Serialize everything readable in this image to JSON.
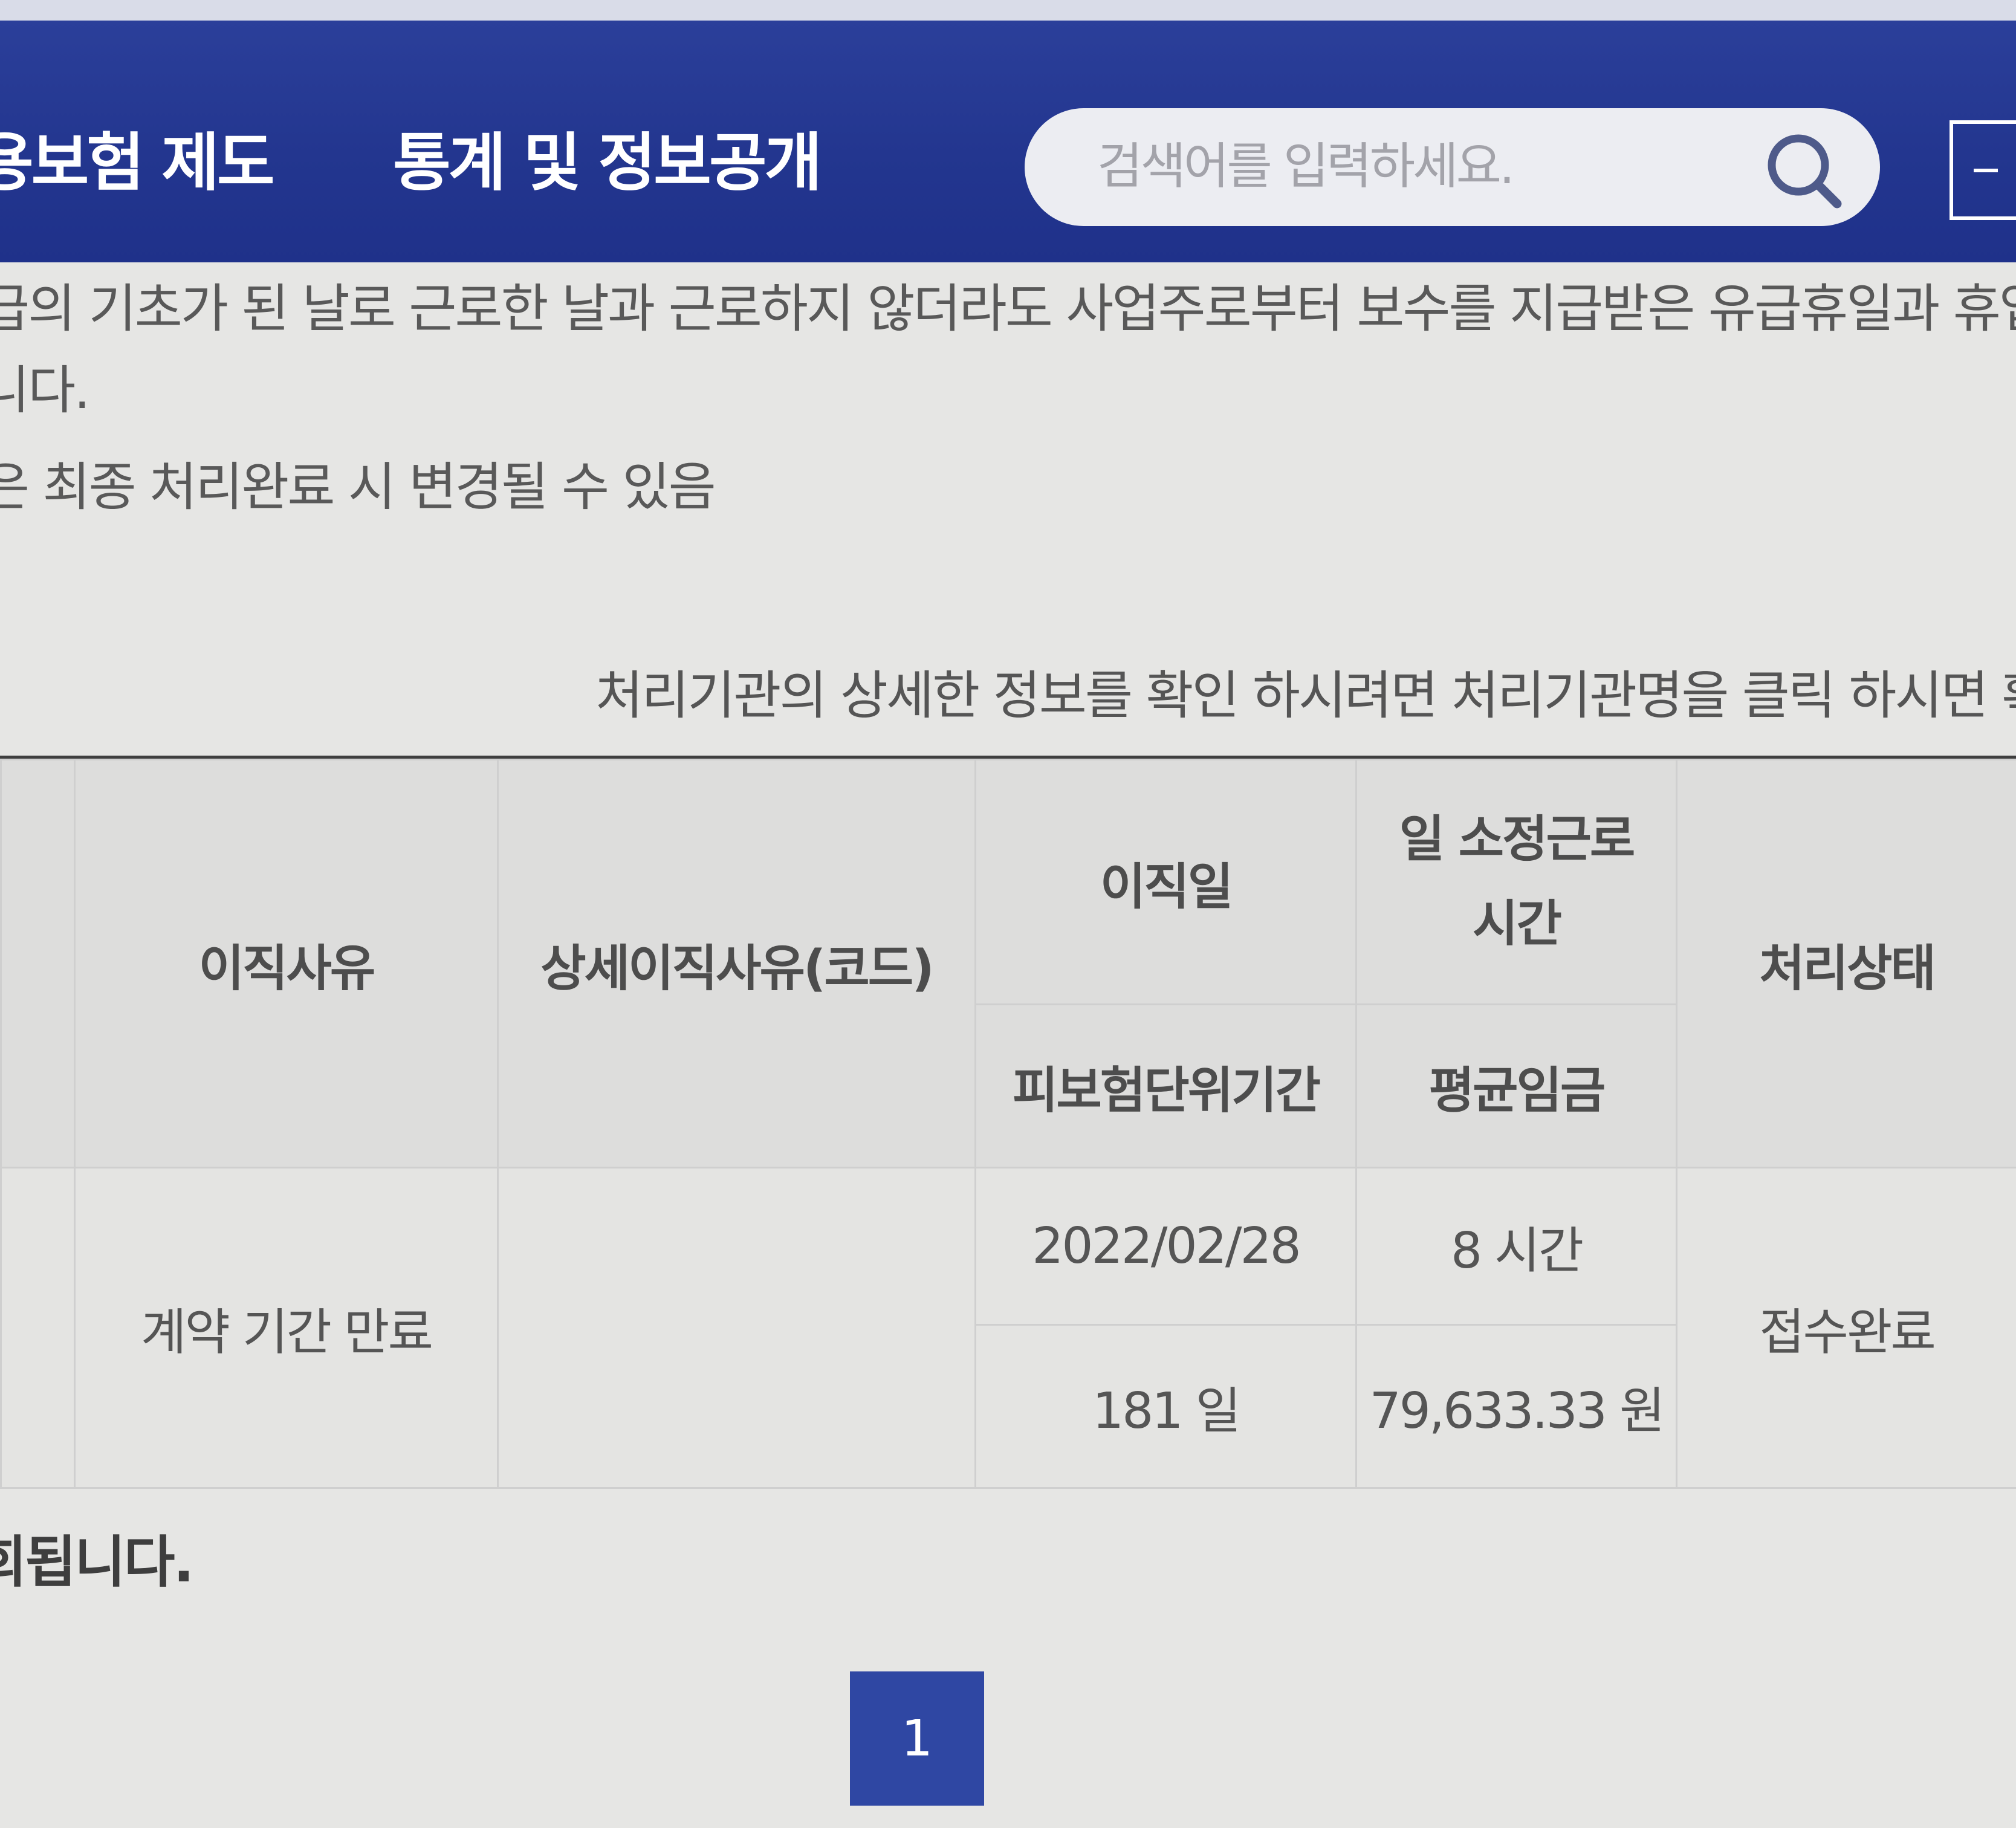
{
  "nav": {
    "item1": "용보험 제도",
    "item2": "통계 및 정보공개"
  },
  "search": {
    "placeholder": "검색어를 입력하세요."
  },
  "info": {
    "line1": "급의 기초가 된 날로 근로한 날과 근로하지 않더라도 사업주로부터 보수를 지급받은 유급휴일과 휴업수",
    "line2": "니다.",
    "line3": "은 최종 처리완료 시 변경될 수 있음",
    "notice": "처리기관의 상세한 정보를 확인 하시려면 처리기관명을 클릭 하시면 확인"
  },
  "table": {
    "headers": {
      "reason": "이직사유",
      "detail_reason": "상세이직사유(코드)",
      "leave_date": "이직일",
      "daily_hours_1": "일 소정근로",
      "daily_hours_2": "시간",
      "status": "처리상태",
      "insured_period": "피보험단위기간",
      "avg_wage": "평균임금"
    },
    "row": {
      "reason": "계약 기간 만료",
      "detail_reason": "",
      "leave_date": "2022/02/28",
      "daily_hours": "8 시간",
      "insured_period": "181 일",
      "avg_wage": "79,633.33 원",
      "status": "접수완료"
    }
  },
  "footnote": "회됩니다.",
  "pagination": {
    "current": "1"
  },
  "colors": {
    "header_bg": "#23368f",
    "page_btn": "#2f47a3"
  }
}
